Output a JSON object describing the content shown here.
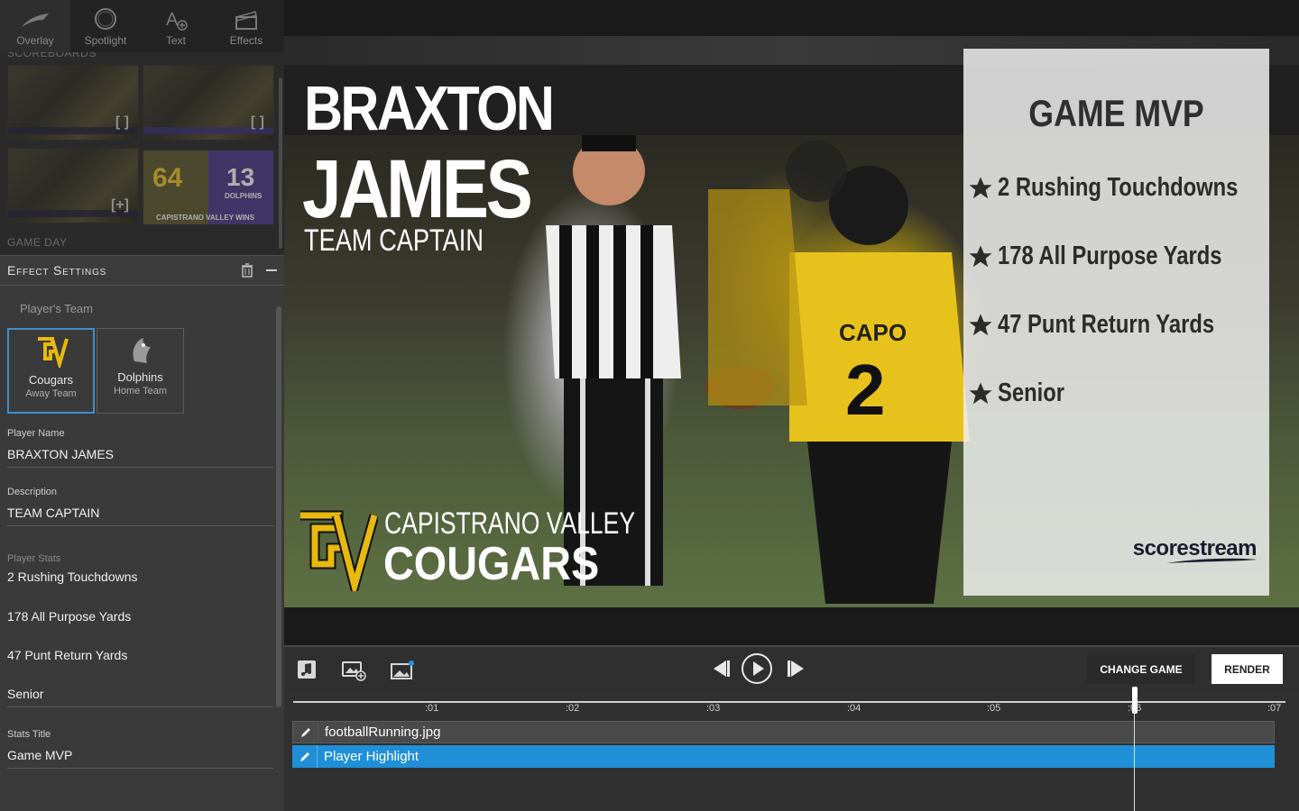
{
  "toolbar": {
    "tools": [
      {
        "label": "Overlay",
        "icon": "swoosh-icon"
      },
      {
        "label": "Spotlight",
        "icon": "spotlight-icon"
      },
      {
        "label": "Text",
        "icon": "text-add-icon"
      },
      {
        "label": "Effects",
        "icon": "clapperboard-icon"
      }
    ]
  },
  "library": {
    "scoreboards_label": "SCOREBOARDS",
    "gameday_label": "GAME DAY",
    "thumb_score": {
      "left": "64",
      "right": "13",
      "right_team": "DOLPHINS",
      "caption": "CAPISTRANO VALLEY WINS"
    }
  },
  "effect_settings": {
    "title": "Effect Settings",
    "players_team_label": "Player's Team",
    "teams": [
      {
        "name": "Cougars",
        "role": "Away Team",
        "selected": true
      },
      {
        "name": "Dolphins",
        "role": "Home Team",
        "selected": false
      }
    ],
    "player_name_label": "Player Name",
    "player_name": "BRAXTON JAMES",
    "description_label": "Description",
    "description": "TEAM CAPTAIN",
    "player_stats_label": "Player Stats",
    "stats": [
      "2 Rushing Touchdowns",
      "178 All Purpose Yards",
      "47 Punt Return Yards",
      "Senior"
    ],
    "stats_title_label": "Stats Title",
    "stats_title": "Game MVP"
  },
  "preview": {
    "first_name": "BRAXTON",
    "last_name": "JAMES",
    "description": "TEAM CAPTAIN",
    "school": "CAPISTRANO VALLEY",
    "mascot": "COUGARS",
    "mvp_title": "GAME MVP",
    "mvp_stats": [
      "2 Rushing Touchdowns",
      "178 All Purpose Yards",
      "47 Punt Return Yards",
      "Senior"
    ],
    "brand": "scorestream",
    "jersey_text": "CAPO",
    "jersey_number": "2"
  },
  "controls": {
    "change_game": "CHANGE GAME",
    "render": "RENDER"
  },
  "timeline": {
    "ticks": [
      ":01",
      ":02",
      ":03",
      ":04",
      ":05",
      ":06",
      ":07"
    ],
    "tracks": [
      {
        "label": "footballRunning.jpg"
      },
      {
        "label": "Player Highlight"
      }
    ]
  },
  "colors": {
    "accent": "#1f8fd8",
    "cougars_gold": "#e8b90f",
    "panel": "#3a3a3a"
  }
}
